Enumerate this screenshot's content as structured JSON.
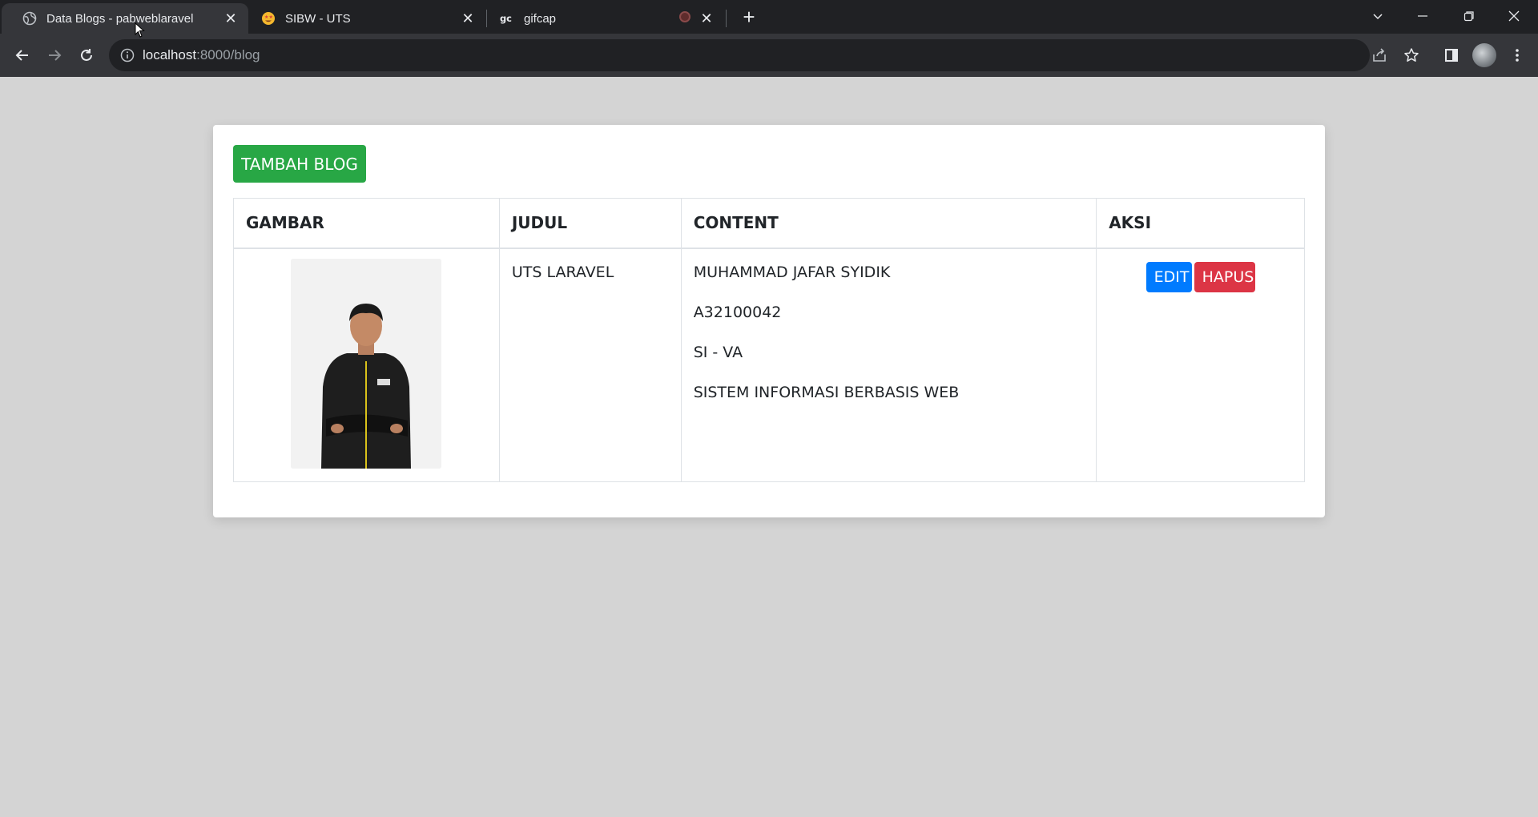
{
  "browser": {
    "tabs": [
      {
        "title": "Data Blogs - pabweblaravel",
        "active": true,
        "favicon": "globe-icon"
      },
      {
        "title": "SIBW - UTS",
        "active": false,
        "favicon": "star-eyes-emoji-icon"
      },
      {
        "title": "gifcap",
        "active": false,
        "favicon": "gifcap-logo-icon"
      }
    ],
    "address": {
      "host": "localhost",
      "path": ":8000/blog"
    }
  },
  "page": {
    "add_button": "TAMBAH BLOG",
    "table": {
      "headers": [
        "GAMBAR",
        "JUDUL",
        "CONTENT",
        "AKSI"
      ],
      "rows": [
        {
          "judul": "UTS LARAVEL",
          "content": [
            "MUHAMMAD JAFAR SYIDIK",
            "A32100042",
            "SI - VA",
            "SISTEM INFORMASI BERBASIS WEB"
          ],
          "edit_label": "EDIT",
          "hapus_label": "HAPUS"
        }
      ]
    }
  },
  "colors": {
    "success": "#28a745",
    "primary": "#007bff",
    "danger": "#dc3545",
    "page_bg": "#d4d4d4"
  }
}
